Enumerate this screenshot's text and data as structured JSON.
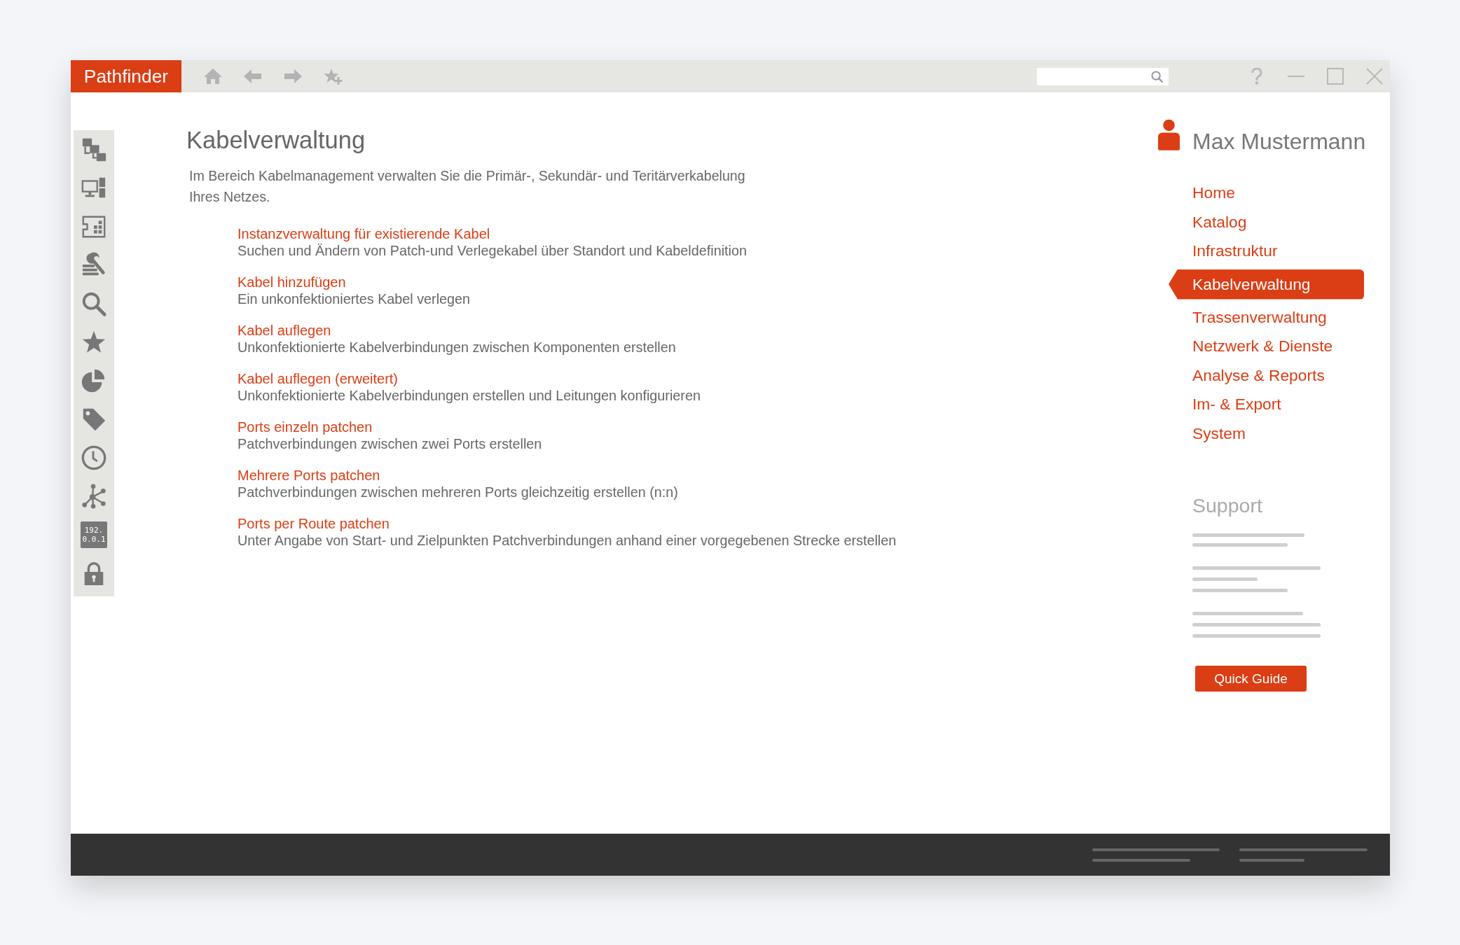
{
  "window": {
    "title": "Pathfinder"
  },
  "sidebar": {
    "address_tile": [
      "192.",
      "0.0.1"
    ]
  },
  "page": {
    "title": "Kabelverwaltung",
    "intro": "Im Bereich Kabelmanagement verwalten Sie die Primär-, Sekundär- und Teritärverkabelung\nIhres Netzes.",
    "links": [
      {
        "title": "Instanzverwaltung für existierende Kabel",
        "description": "Suchen und Ändern von Patch-und Verlegekabel über Standort und Kabeldefinition"
      },
      {
        "title": "Kabel hinzufügen",
        "description": "Ein unkonfektioniertes Kabel verlegen"
      },
      {
        "title": "Kabel auflegen",
        "description": "Unkonfektionierte Kabelverbindungen zwischen Komponenten erstellen"
      },
      {
        "title": "Kabel auflegen (erweitert)",
        "description": "Unkonfektionierte Kabelverbindungen erstellen und Leitungen konfigurieren"
      },
      {
        "title": "Ports einzeln patchen",
        "description": "Patchverbindungen zwischen zwei Ports erstellen"
      },
      {
        "title": "Mehrere Ports patchen",
        "description": "Patchverbindungen zwischen mehreren Ports gleichzeitig erstellen (n:n)"
      },
      {
        "title": "Ports per Route patchen",
        "description": "Unter Angabe von Start- und Zielpunkten Patchverbindungen anhand einer vorgegebenen Strecke erstellen"
      }
    ]
  },
  "user": {
    "name": "Max Mustermann"
  },
  "navigation": [
    {
      "label": "Home",
      "selected": false
    },
    {
      "label": "Katalog",
      "selected": false
    },
    {
      "label": "Infrastruktur",
      "selected": false
    },
    {
      "label": "Kabelverwaltung",
      "selected": true
    },
    {
      "label": "Trassenverwaltung",
      "selected": false
    },
    {
      "label": "Netzwerk & Dienste",
      "selected": false
    },
    {
      "label": "Analyse & Reports",
      "selected": false
    },
    {
      "label": "Im- & Export",
      "selected": false
    },
    {
      "label": "System",
      "selected": false
    }
  ],
  "support": {
    "title": "Support",
    "button": "Quick Guide"
  }
}
